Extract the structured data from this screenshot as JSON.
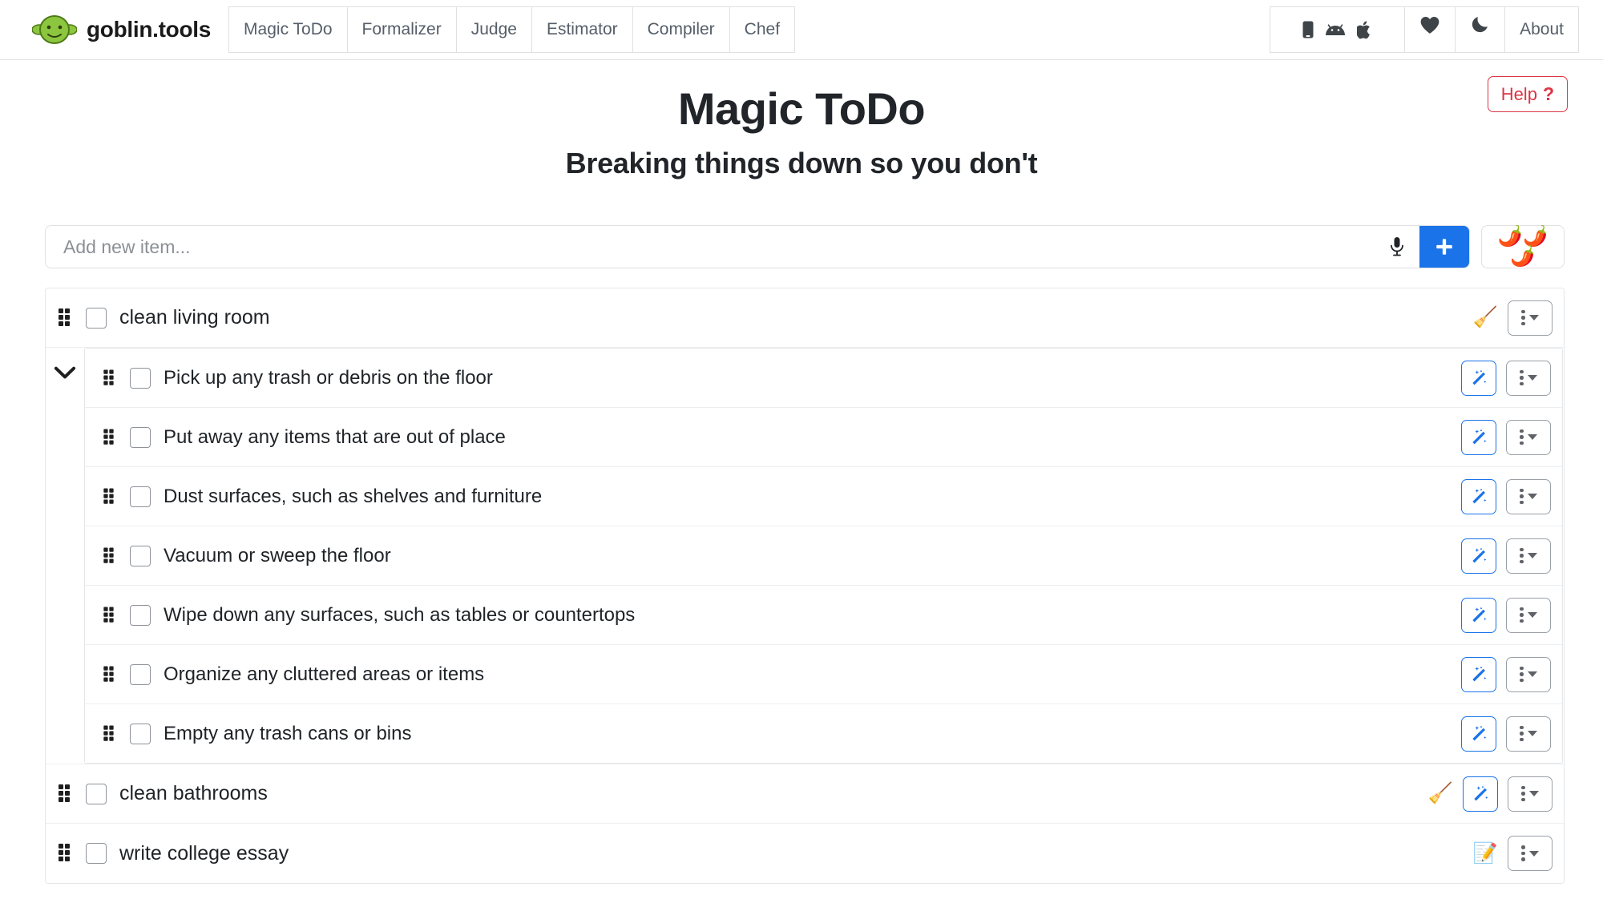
{
  "navbar": {
    "brand_name": "goblin.tools",
    "logo_icon": "goblin-head-icon",
    "tabs": [
      {
        "label": "Magic ToDo",
        "name": "tab-magic-todo"
      },
      {
        "label": "Formalizer",
        "name": "tab-formalizer"
      },
      {
        "label": "Judge",
        "name": "tab-judge"
      },
      {
        "label": "Estimator",
        "name": "tab-estimator"
      },
      {
        "label": "Compiler",
        "name": "tab-compiler"
      },
      {
        "label": "Chef",
        "name": "tab-chef"
      }
    ],
    "apps_icons": [
      "mobile-phone-icon",
      "android-icon",
      "apple-icon"
    ],
    "favorite_icon": "heart-icon",
    "theme_icon": "moon-icon",
    "about_label": "About"
  },
  "header": {
    "title": "Magic ToDo",
    "subtitle": "Breaking things down so you don't",
    "help_label": "Help",
    "help_mark": "?",
    "help_color": "#dc3545"
  },
  "composer": {
    "placeholder": "Add new item...",
    "value": "",
    "mic_icon": "microphone-icon",
    "add_label": "+",
    "add_color": "#1a73e8",
    "spice_level": "🌶️🌶️🌶️",
    "spice_count": 3
  },
  "todos": [
    {
      "label": "clean living room",
      "checked": false,
      "emoji": "🧹",
      "emoji_name": "broom-icon",
      "has_wand": false,
      "expanded": true,
      "children": [
        {
          "label": "Pick up any trash or debris on the floor",
          "checked": false,
          "has_wand": true
        },
        {
          "label": "Put away any items that are out of place",
          "checked": false,
          "has_wand": true
        },
        {
          "label": "Dust surfaces, such as shelves and furniture",
          "checked": false,
          "has_wand": true
        },
        {
          "label": "Vacuum or sweep the floor",
          "checked": false,
          "has_wand": true
        },
        {
          "label": "Wipe down any surfaces, such as tables or countertops",
          "checked": false,
          "has_wand": true
        },
        {
          "label": "Organize any cluttered areas or items",
          "checked": false,
          "has_wand": true
        },
        {
          "label": "Empty any trash cans or bins",
          "checked": false,
          "has_wand": true
        }
      ]
    },
    {
      "label": "clean bathrooms",
      "checked": false,
      "emoji": "🧹",
      "emoji_name": "broom-icon",
      "has_wand": true,
      "expanded": false,
      "children": []
    },
    {
      "label": "write college essay",
      "checked": false,
      "emoji": "📝",
      "emoji_name": "memo-icon",
      "has_wand": false,
      "expanded": false,
      "children": []
    }
  ]
}
